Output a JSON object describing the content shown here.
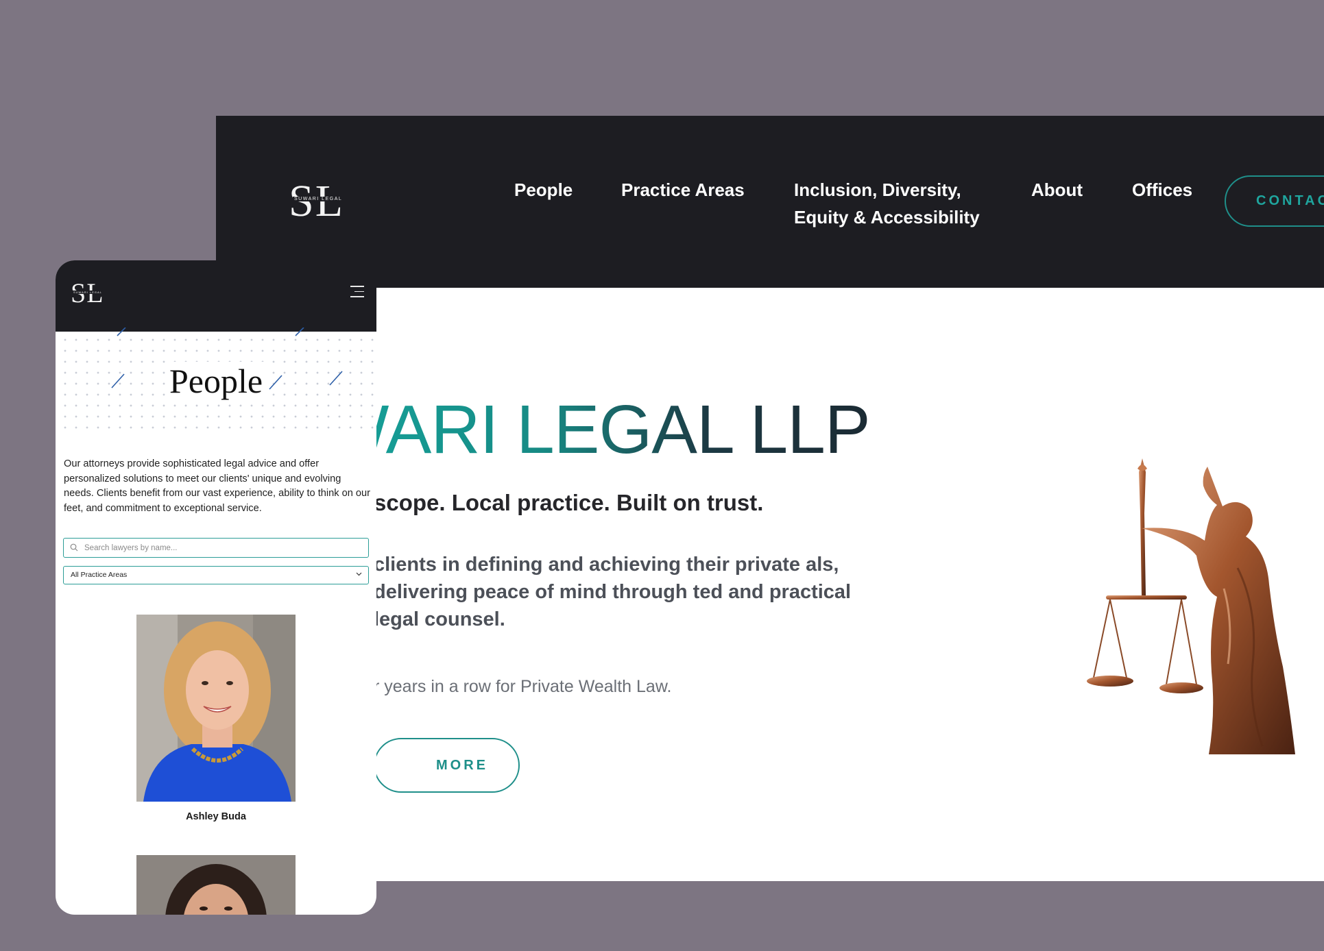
{
  "desktop": {
    "logo": {
      "letters": "SL",
      "tagline": "SUWARI LEGAL"
    },
    "nav": {
      "items": [
        "People",
        "Practice Areas",
        "Inclusion, Diversity, Equity & Accessibility",
        "About",
        "Offices"
      ],
      "contact_label": "CONTAC"
    },
    "hero": {
      "title": "WARI LEGAL LLP",
      "tagline": "scope. Local practice. Built on trust.",
      "description": "clients in defining and achieving their private als, delivering peace of mind through ted and practical legal counsel.",
      "award": "r years in a row for Private Wealth Law.",
      "more_label": "MORE"
    }
  },
  "mobile": {
    "logo": {
      "letters": "SL",
      "tagline": "SUWARI LEGAL"
    },
    "page_title": "People",
    "intro": "Our attorneys provide sophisticated legal advice and offer personalized solutions to meet our clients' unique and evolving needs. Clients benefit from our vast experience, ability to think on our feet, and commitment to exceptional service.",
    "search": {
      "placeholder": "Search lawyers by name..."
    },
    "filter": {
      "selected": "All Practice Areas"
    },
    "lawyers": [
      {
        "name": "Ashley Buda"
      },
      {
        "name": ""
      }
    ]
  },
  "colors": {
    "background": "#7d7582",
    "nav_dark": "#1d1d22",
    "accent_teal": "#1f8f8a"
  },
  "icons": [
    "search-icon",
    "chevron-down-icon",
    "hamburger-menu-icon",
    "scales-of-justice-statue"
  ]
}
